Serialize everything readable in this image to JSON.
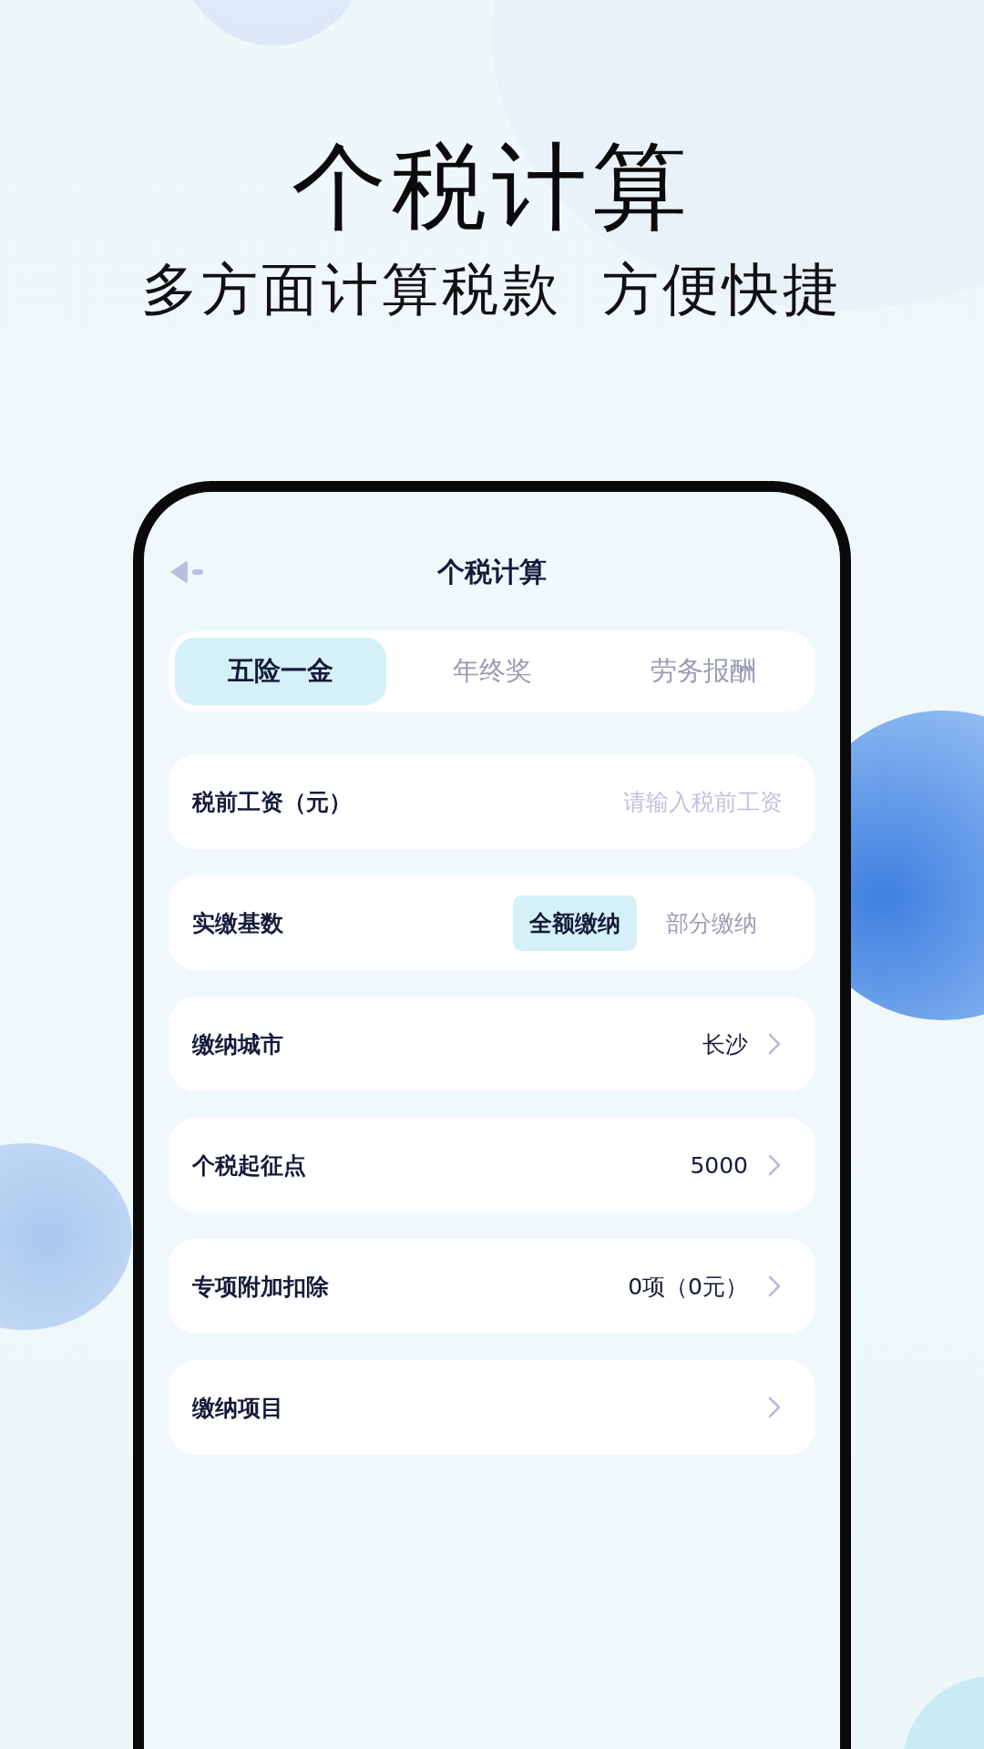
{
  "headline": "个税计算",
  "subtitle": [
    "多方面计算税款",
    "方便快捷"
  ],
  "screen": {
    "title": "个税计算",
    "tabs": [
      {
        "label": "五险一金",
        "selected": true
      },
      {
        "label": "年终奖",
        "selected": false
      },
      {
        "label": "劳务报酬",
        "selected": false
      }
    ],
    "rows": [
      {
        "kind": "input",
        "label": "税前工资（元）",
        "placeholder": "请输入税前工资"
      },
      {
        "kind": "segmented",
        "label": "实缴基数",
        "options": [
          {
            "label": "全额缴纳",
            "selected": true
          },
          {
            "label": "部分缴纳",
            "selected": false
          }
        ]
      },
      {
        "kind": "link",
        "label": "缴纳城市",
        "value": "长沙"
      },
      {
        "kind": "link",
        "label": "个税起征点",
        "value": "5000"
      },
      {
        "kind": "link",
        "label": "专项附加扣除",
        "value": "0项（0元）"
      },
      {
        "kind": "link",
        "label": "缴纳项目"
      }
    ]
  }
}
